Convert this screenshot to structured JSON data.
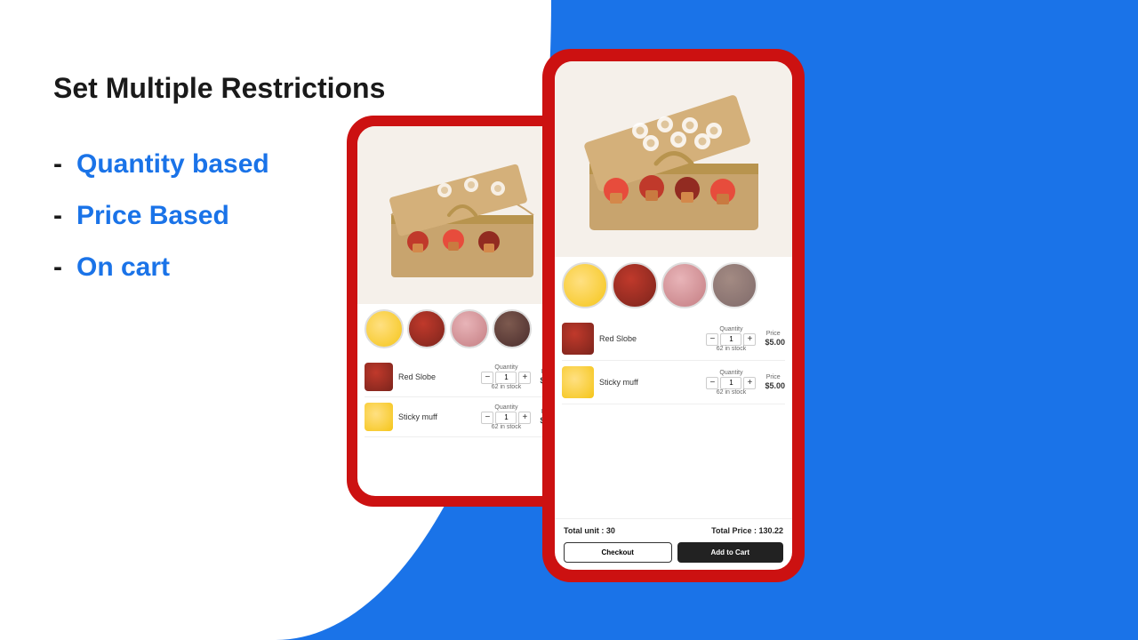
{
  "page": {
    "background_color": "#1a73e8"
  },
  "left": {
    "title": "Set Multiple Restrictions",
    "features": [
      {
        "dash": "-",
        "text": "Quantity based"
      },
      {
        "dash": "-",
        "text": "Price Based"
      },
      {
        "dash": "-",
        "text": "On cart"
      }
    ]
  },
  "phone_small": {
    "product_image_alt": "Cupcake box product image",
    "thumbnails": [
      "yellow cupcake",
      "brown cupcake",
      "pink cupcake",
      "dark cupcake"
    ],
    "rows": [
      {
        "name": "Red Slobe",
        "qty_label": "Quantity",
        "stock": "62 in stock",
        "price_label": "Price",
        "price": "$5.00"
      },
      {
        "name": "Sticky muff",
        "qty_label": "Quantity",
        "stock": "62 in stock",
        "price_label": "Price",
        "price": "$5.00"
      }
    ]
  },
  "phone_large": {
    "product_image_alt": "Cupcake box product image",
    "thumbnails": [
      "yellow cupcake",
      "brown cupcake",
      "pink cupcake",
      "dark cupcake"
    ],
    "rows": [
      {
        "name": "Red Slobe",
        "qty_label": "Quantity",
        "stock": "62 in stock",
        "price_label": "Price",
        "price": "$5.00"
      },
      {
        "name": "Sticky muff",
        "qty_label": "Quantity",
        "stock": "62 in stock",
        "price_label": "Price",
        "price": "$5.00"
      }
    ],
    "total_units_label": "Total unit : 30",
    "total_price_label": "Total Price : 130.22",
    "checkout_btn": "Checkout",
    "addcart_btn": "Add to Cart"
  },
  "icons": {
    "minus": "−",
    "plus": "+"
  }
}
